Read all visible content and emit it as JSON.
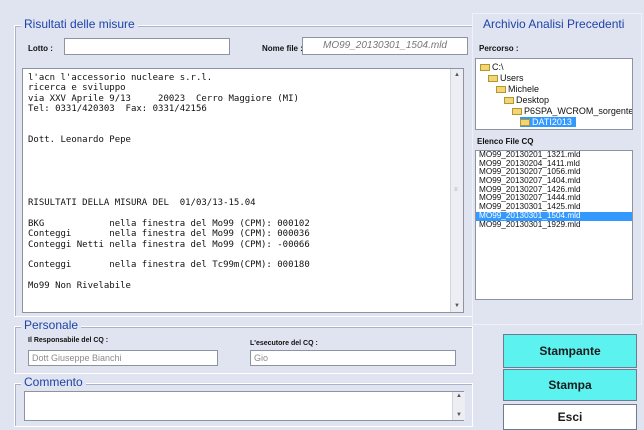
{
  "misure": {
    "title": "Risultati delle misure",
    "lotto_label": "Lotto :",
    "lotto_value": "",
    "nomefile_label": "Nome file :",
    "nomefile_value": "MO99_20130301_1504.mld",
    "report_lines": [
      "l'acn l'accessorio nucleare s.r.l.",
      "ricerca e sviluppo",
      "via XXV Aprile 9/13     20023  Cerro Maggiore (MI)",
      "Tel: 0331/420303  Fax: 0331/42156",
      "",
      "",
      "Dott. Leonardo Pepe",
      "",
      "",
      "",
      "",
      "",
      "RISULTATI DELLA MISURA DEL  01/03/13-15.04",
      "",
      "BKG            nella finestra del Mo99 (CPM): 000102",
      "Conteggi       nella finestra del Mo99 (CPM): 000036",
      "Conteggi Netti nella finestra del Mo99 (CPM): -00066",
      "",
      "Conteggi       nella finestra del Tc99m(CPM): 000180",
      "",
      "Mo99 Non Rivelabile"
    ]
  },
  "personale": {
    "title": "Personale",
    "responsabile_label": "Il Responsabile del CQ :",
    "responsabile_value": "Dott Giuseppe Bianchi",
    "esecutore_label": "L'esecutore del CQ :",
    "esecutore_value": "Gio"
  },
  "commento": {
    "title": "Commento",
    "value": ""
  },
  "archivio": {
    "title": "Archivio Analisi Precedenti",
    "percorso_label": "Percorso :",
    "tree": [
      {
        "label": "C:\\",
        "level": 0,
        "selected": false
      },
      {
        "label": "Users",
        "level": 1,
        "selected": false
      },
      {
        "label": "Michele",
        "level": 2,
        "selected": false
      },
      {
        "label": "Desktop",
        "level": 3,
        "selected": false
      },
      {
        "label": "P6SPA_WCROM_sorgente",
        "level": 4,
        "selected": false
      },
      {
        "label": "DATI2013",
        "level": 5,
        "selected": true
      }
    ],
    "elenco_label": "Elenco File CQ",
    "files": [
      {
        "name": "MO99_20130201_1321.mld",
        "selected": false
      },
      {
        "name": "MO99_20130204_1411.mld",
        "selected": false
      },
      {
        "name": "MO99_20130207_1056.mld",
        "selected": false
      },
      {
        "name": "MO99_20130207_1404.mld",
        "selected": false
      },
      {
        "name": "MO99_20130207_1426.mld",
        "selected": false
      },
      {
        "name": "MO99_20130207_1444.mld",
        "selected": false
      },
      {
        "name": "MO99_20130301_1425.mld",
        "selected": false
      },
      {
        "name": "MO99_20130301_1504.mld",
        "selected": true
      },
      {
        "name": "MO99_20130301_1929.mld",
        "selected": false
      }
    ]
  },
  "buttons": {
    "stampante": "Stampante",
    "stampa": "Stampa",
    "esci": "Esci"
  },
  "colors": {
    "accent_title": "#1f43a8",
    "selection": "#3399ff",
    "button_teal": "#5cf2f0"
  }
}
